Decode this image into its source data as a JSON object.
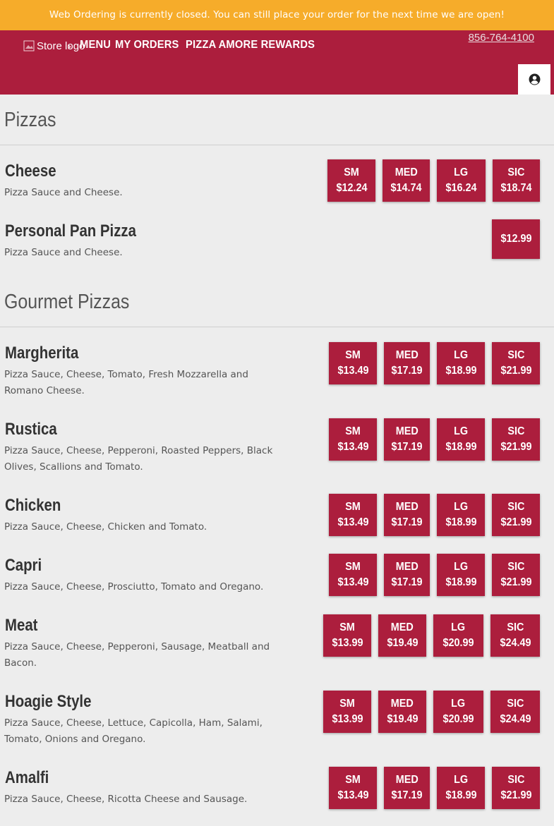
{
  "banner": {
    "text": "Web Ordering is currently closed. You can still place your order for the next time we are open!"
  },
  "header": {
    "logo_alt": "Store logo",
    "nav": {
      "menu": "MENU",
      "my_orders": "MY ORDERS",
      "rewards": "PIZZA AMORE REWARDS"
    },
    "phone": "856-764-4100",
    "account_icon": "user-circle-icon"
  },
  "colors": {
    "brand": "#ac1e3d",
    "banner": "#f6ac2a",
    "background": "#ededed"
  },
  "sections": {
    "pizzas": {
      "title": "Pizzas",
      "items": {
        "cheese": {
          "name": "Cheese",
          "desc": "Pizza Sauce and Cheese.",
          "prices": [
            {
              "size": "SM",
              "price": "$12.24"
            },
            {
              "size": "MED",
              "price": "$14.74"
            },
            {
              "size": "LG",
              "price": "$16.24"
            },
            {
              "size": "SIC",
              "price": "$18.74"
            }
          ]
        },
        "personal": {
          "name": "Personal Pan Pizza",
          "desc": "Pizza Sauce and Cheese.",
          "prices": [
            {
              "price": "$12.99"
            }
          ]
        }
      }
    },
    "gourmet": {
      "title": "Gourmet Pizzas",
      "items": {
        "margherita": {
          "name": "Margherita",
          "desc": "Pizza Sauce, Cheese, Tomato, Fresh Mozzarella and Romano Cheese.",
          "prices": [
            {
              "size": "SM",
              "price": "$13.49"
            },
            {
              "size": "MED",
              "price": "$17.19"
            },
            {
              "size": "LG",
              "price": "$18.99"
            },
            {
              "size": "SIC",
              "price": "$21.99"
            }
          ]
        },
        "rustica": {
          "name": "Rustica",
          "desc": "Pizza Sauce, Cheese, Pepperoni, Roasted Peppers, Black Olives, Scallions and Tomato.",
          "prices": [
            {
              "size": "SM",
              "price": "$13.49"
            },
            {
              "size": "MED",
              "price": "$17.19"
            },
            {
              "size": "LG",
              "price": "$18.99"
            },
            {
              "size": "SIC",
              "price": "$21.99"
            }
          ]
        },
        "chicken": {
          "name": "Chicken",
          "desc": "Pizza Sauce, Cheese, Chicken and Tomato.",
          "prices": [
            {
              "size": "SM",
              "price": "$13.49"
            },
            {
              "size": "MED",
              "price": "$17.19"
            },
            {
              "size": "LG",
              "price": "$18.99"
            },
            {
              "size": "SIC",
              "price": "$21.99"
            }
          ]
        },
        "capri": {
          "name": "Capri",
          "desc": "Pizza Sauce, Cheese, Prosciutto, Tomato and Oregano.",
          "prices": [
            {
              "size": "SM",
              "price": "$13.49"
            },
            {
              "size": "MED",
              "price": "$17.19"
            },
            {
              "size": "LG",
              "price": "$18.99"
            },
            {
              "size": "SIC",
              "price": "$21.99"
            }
          ]
        },
        "meat": {
          "name": "Meat",
          "desc": "Pizza Sauce, Cheese, Pepperoni, Sausage, Meatball and Bacon.",
          "prices": [
            {
              "size": "SM",
              "price": "$13.99"
            },
            {
              "size": "MED",
              "price": "$19.49"
            },
            {
              "size": "LG",
              "price": "$20.99"
            },
            {
              "size": "SIC",
              "price": "$24.49"
            }
          ]
        },
        "hoagie": {
          "name": "Hoagie Style",
          "desc": "Pizza Sauce, Cheese, Lettuce, Capicolla, Ham, Salami, Tomato, Onions and Oregano.",
          "prices": [
            {
              "size": "SM",
              "price": "$13.99"
            },
            {
              "size": "MED",
              "price": "$19.49"
            },
            {
              "size": "LG",
              "price": "$20.99"
            },
            {
              "size": "SIC",
              "price": "$24.49"
            }
          ]
        },
        "amalfi": {
          "name": "Amalfi",
          "desc": "Pizza Sauce, Cheese, Ricotta Cheese and Sausage.",
          "prices": [
            {
              "size": "SM",
              "price": "$13.49"
            },
            {
              "size": "MED",
              "price": "$17.19"
            },
            {
              "size": "LG",
              "price": "$18.99"
            },
            {
              "size": "SIC",
              "price": "$21.99"
            }
          ]
        }
      }
    }
  }
}
